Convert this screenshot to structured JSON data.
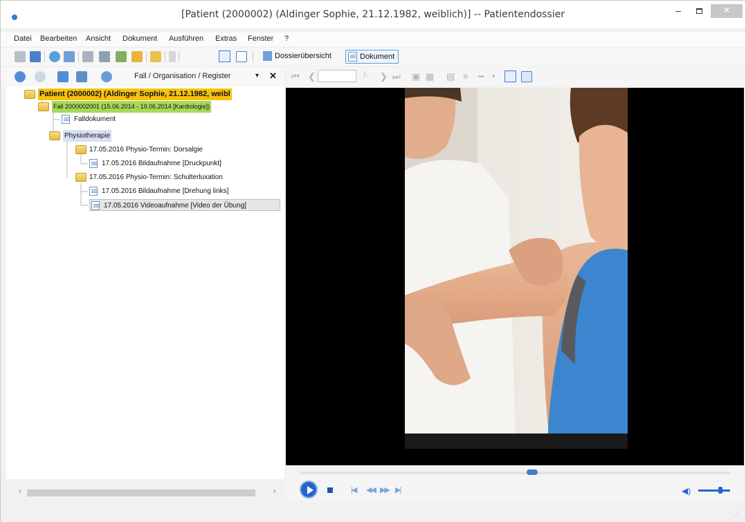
{
  "window": {
    "title": "[Patient (2000002) (Aldinger Sophie, 21.12.1982, weiblich)] -- Patientendossier",
    "min_glyph": "–",
    "close_glyph": "✕"
  },
  "menu": [
    "Datei",
    "Bearbeiten",
    "Ansicht",
    "Dokument",
    "Ausführen",
    "Extras",
    "Fenster",
    "?"
  ],
  "toolbar": {
    "dossier_label": "Dossierübersicht",
    "document_label": "Dokument"
  },
  "navigation": {
    "breadcrumb": "Fall / Organisation / Register",
    "dropdown_glyph": "▾",
    "close_glyph": "✕"
  },
  "tree": {
    "patient": "Patient (2000002) (Aldinger Sophie, 21.12.1982, weibl",
    "case": "Fall 2000002001 (15.06.2014 - 19.06.2014 [Kardiologie])",
    "case_document": "Falldokument",
    "physio": "Physiotherapie",
    "appointment1": "17.05.2016 Physio-Termin: Dorsalgie",
    "appointment1_image": "17.05.2016 Bildaufnahme [Druckpunkt]",
    "appointment2": "17.05.2016 Physio-Termin: Schulterluxation",
    "appointment2_image": "17.05.2016 Bildaufnahme [Drehung links]",
    "appointment2_video": "17.05.2016 Videoaufnahme [Video der Übung]"
  },
  "scrollbar": {
    "left_glyph": "‹",
    "right_glyph": "›"
  },
  "viewer": {
    "page_separator": "/-"
  },
  "player": {
    "position_fraction": 0.54,
    "volume_fraction": 0.7
  },
  "colors": {
    "patient_highlight": "#f6c20e",
    "case_highlight": "#a8d85a",
    "physio_highlight": "#d8e0f4",
    "selected_row": "#e6e6e6",
    "accent": "#2366c9"
  }
}
